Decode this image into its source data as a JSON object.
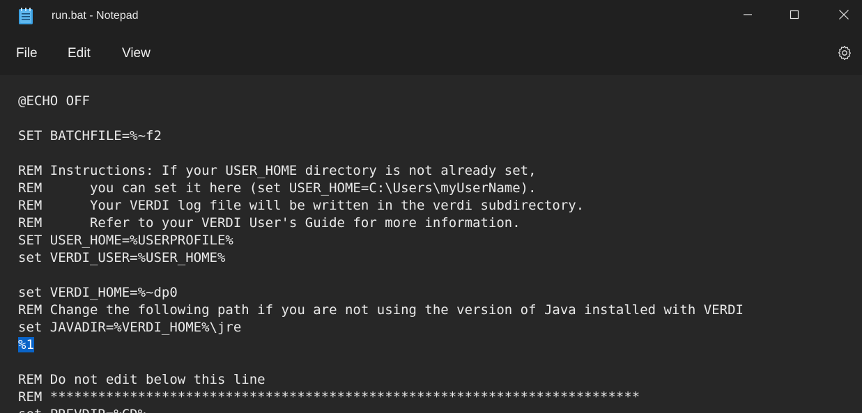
{
  "window": {
    "title": "run.bat - Notepad"
  },
  "menu": {
    "file": "File",
    "edit": "Edit",
    "view": "View"
  },
  "icons": {
    "app": "notepad-icon",
    "minimize": "minimize-icon",
    "maximize": "maximize-icon",
    "close": "close-icon",
    "settings": "gear-icon"
  },
  "colors": {
    "selection": "#0a64c8",
    "background": "#272727",
    "titlebar": "#202020"
  },
  "editor": {
    "lines": [
      "@ECHO OFF",
      "",
      "SET BATCHFILE=%~f2",
      "",
      "REM Instructions: If your USER_HOME directory is not already set,",
      "REM      you can set it here (set USER_HOME=C:\\Users\\myUserName).",
      "REM      Your VERDI log file will be written in the verdi subdirectory.",
      "REM      Refer to your VERDI User's Guide for more information.",
      "SET USER_HOME=%USERPROFILE%",
      "set VERDI_USER=%USER_HOME%",
      "",
      "set VERDI_HOME=%~dp0",
      "REM Change the following path if you are not using the version of Java installed with VERDI",
      "set JAVADIR=%VERDI_HOME%\\jre",
      "%1",
      "",
      "REM Do not edit below this line",
      "REM **************************************************************************",
      "set PREVDIR=%CD%"
    ],
    "selected_line_index": 14,
    "selected_text": "%1"
  }
}
